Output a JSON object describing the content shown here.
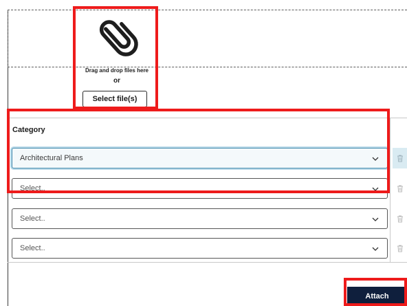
{
  "dropzone": {
    "icon": "paperclip-icon",
    "drag_text": "Drag and drop files here",
    "or_text": "or",
    "select_files_label": "Select file(s)"
  },
  "table": {
    "category_header": "Category",
    "rows": [
      {
        "value": "Architectural Plans",
        "placeholder": false
      },
      {
        "value": "Select..",
        "placeholder": true
      },
      {
        "value": "Select..",
        "placeholder": true
      },
      {
        "value": "Select..",
        "placeholder": true
      }
    ]
  },
  "actions": {
    "attach_label": "Attach"
  },
  "colors": {
    "highlight": "#ee1b1b",
    "attach_bg": "#0f1f3d",
    "active_select_border": "#4a8fb0"
  }
}
